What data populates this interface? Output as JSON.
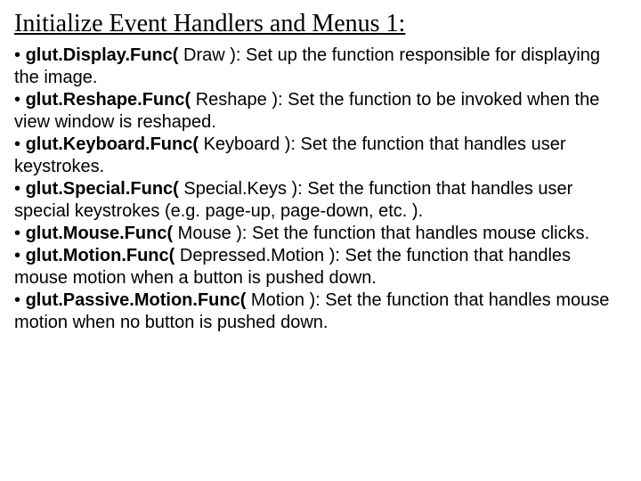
{
  "title": "Initialize Event Handlers and Menus 1:",
  "bullets": [
    {
      "bold": "glut.Display.Func(",
      "arg": " Draw ):",
      "rest": " Set up the function responsible for displaying the image."
    },
    {
      "bold": "glut.Reshape.Func(",
      "arg": " Reshape ):",
      "rest": " Set the function to be invoked when the view window is reshaped."
    },
    {
      "bold": "glut.Keyboard.Func(",
      "arg": " Keyboard ):",
      "rest": " Set the function that handles user keystrokes."
    },
    {
      "bold": "glut.Special.Func(",
      "arg": " Special.Keys ):",
      "rest": " Set the function that handles user special keystrokes (e.g. page-up, page-down, etc. )."
    },
    {
      "bold": "glut.Mouse.Func(",
      "arg": " Mouse ):",
      "rest": " Set the function that handles mouse clicks."
    },
    {
      "bold": "glut.Motion.Func(",
      "arg": " Depressed.Motion ):",
      "rest": " Set the function that handles mouse motion when a button is pushed down."
    },
    {
      "bold": "glut.Passive.Motion.Func(",
      "arg": " Motion ):",
      "rest": " Set the function that handles mouse motion when no button is pushed down."
    }
  ],
  "bullet_char": "•"
}
